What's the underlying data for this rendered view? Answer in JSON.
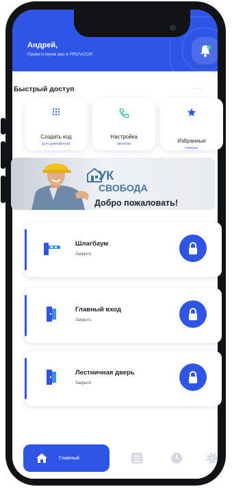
{
  "header": {
    "user_name": "Андрей,",
    "greeting": "Приветствуем вас в PROVIZOR"
  },
  "quick_access": {
    "title": "Быстрый доступ",
    "more": "···",
    "items": [
      {
        "title": "Создать код",
        "subtitle": "для домофонов",
        "icon": "keypad-icon"
      },
      {
        "title": "Настройка",
        "subtitle": "звонков",
        "icon": "phone-icon"
      },
      {
        "title": "Избранные",
        "subtitle": "камеры",
        "icon": "star-icon"
      }
    ]
  },
  "banner": {
    "brand_line1": "УК",
    "brand_line2": "СВОБОДА",
    "welcome": "Добро пожаловать!"
  },
  "doors": [
    {
      "name": "Шлагбаум",
      "status": "Закрыто",
      "icon": "barrier-icon"
    },
    {
      "name": "Главный вход",
      "status": "Закрыто",
      "icon": "door-icon"
    },
    {
      "name": "Лестничная дверь",
      "status": "Закрыто",
      "icon": "door-icon"
    }
  ],
  "tabbar": {
    "active_label": "Главный",
    "items": [
      "home-icon",
      "list-icon",
      "clock-icon",
      "gear-icon"
    ]
  },
  "colors": {
    "accent": "#2e55e6",
    "background": "#f4f6f9"
  }
}
